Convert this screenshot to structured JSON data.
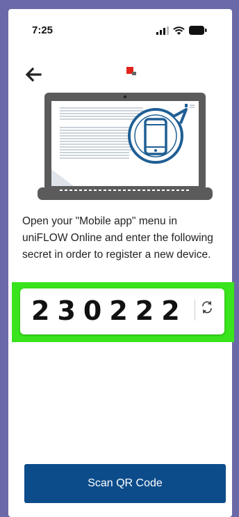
{
  "status_bar": {
    "time": "7:25",
    "icons": [
      "signal-icon",
      "wifi-icon",
      "battery-icon"
    ]
  },
  "header": {
    "back_icon": "arrow-left-icon"
  },
  "illustration": {
    "icon": "laptop-with-phone-icon"
  },
  "instructions": {
    "text": "Open your \"Mobile app\" menu in uniFLOW Online and enter the following secret in order to register a new device."
  },
  "secret": {
    "code": "230222",
    "refresh_icon": "refresh-icon"
  },
  "actions": {
    "scan_label": "Scan QR Code"
  },
  "colors": {
    "primary": "#0d4c8b",
    "highlight": "#39e41c",
    "frame": "#6b6aa8",
    "illustration_stroke": "#1f5f94",
    "accent_red": "#e2231a"
  }
}
